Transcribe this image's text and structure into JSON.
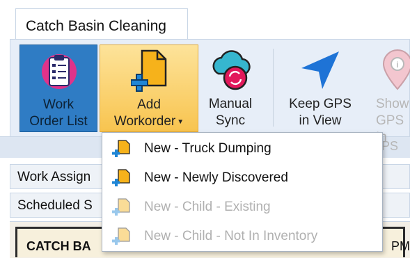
{
  "tab": {
    "label": "Catch Basin Cleaning"
  },
  "ribbon": {
    "work_order_list": {
      "line1": "Work",
      "line2": "Order List"
    },
    "add_workorder": {
      "line1": "Add",
      "line2": "Workorder"
    },
    "manual_sync": {
      "line1": "Manual",
      "line2": "Sync"
    },
    "keep_gps": {
      "line1": "Keep GPS",
      "line2": "in View"
    },
    "show_gps": {
      "line1": "Show",
      "line2": "GPS In"
    },
    "group_label_fragment": "PS"
  },
  "rows": {
    "work_assign": "Work Assign",
    "scheduled": "Scheduled S"
  },
  "panel": {
    "title": "CATCH BA",
    "right": "PM"
  },
  "menu": {
    "items": [
      {
        "label": "New - Truck Dumping",
        "enabled": true
      },
      {
        "label": "New - Newly Discovered",
        "enabled": true
      },
      {
        "label": "New - Child - Existing",
        "enabled": false
      },
      {
        "label": "New - Child - Not In Inventory",
        "enabled": false
      }
    ]
  },
  "colors": {
    "work_order_bg": "#2f7cc4",
    "add_workorder_bg": "#f8c44f",
    "sync_cloud": "#36b6cf",
    "sync_circle": "#e2185b",
    "gps_arrow": "#1e73d6",
    "doc_icon": "#f6b21b",
    "plus_icon": "#1f86d6"
  }
}
